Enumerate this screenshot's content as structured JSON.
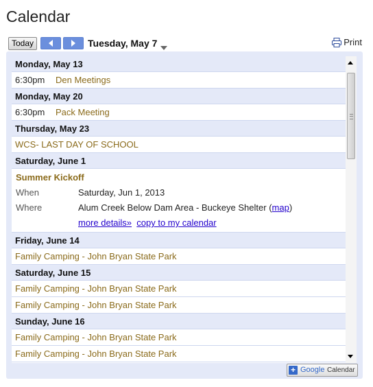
{
  "page": {
    "title": "Calendar"
  },
  "toolbar": {
    "today_label": "Today",
    "current_date": "Tuesday, May 7",
    "print_label": "Print"
  },
  "agenda": [
    {
      "date": "Monday, May 13",
      "events": [
        {
          "time": "6:30pm",
          "title": "Den Meetings"
        }
      ]
    },
    {
      "date": "Monday, May 20",
      "events": [
        {
          "time": "6:30pm",
          "title": "Pack Meeting"
        }
      ]
    },
    {
      "date": "Thursday, May 23",
      "events": [
        {
          "time": "",
          "title": "WCS- LAST DAY OF SCHOOL"
        }
      ]
    },
    {
      "date": "Saturday, June 1",
      "expanded": true
    },
    {
      "date": "Friday, June 14",
      "events": [
        {
          "time": "",
          "title": "Family Camping - John Bryan State Park"
        }
      ]
    },
    {
      "date": "Saturday, June 15",
      "events": [
        {
          "time": "",
          "title": "Family Camping - John Bryan State Park"
        },
        {
          "time": "",
          "title": "Family Camping - John Bryan State Park"
        }
      ]
    },
    {
      "date": "Sunday, June 16",
      "events": [
        {
          "time": "",
          "title": "Family Camping - John Bryan State Park"
        },
        {
          "time": "",
          "title": "Family Camping - John Bryan State Park"
        }
      ]
    }
  ],
  "expanded_event": {
    "title": "Summer Kickoff",
    "when_label": "When",
    "when_value": "Saturday, Jun 1, 2013",
    "where_label": "Where",
    "where_value": "Alum Creek Below Dam Area - Buckeye Shelter",
    "map_open": "(",
    "map_link": "map",
    "map_close": ")",
    "more_details": "more details»",
    "copy_link": "copy to my calendar"
  },
  "footer": {
    "google": "Google",
    "calendar": "Calendar"
  },
  "colors": {
    "event_title": "#8a6a1a",
    "header_bg": "#e4e9f8",
    "nav_blue": "#6b8fdd",
    "link": "#2200cc"
  }
}
